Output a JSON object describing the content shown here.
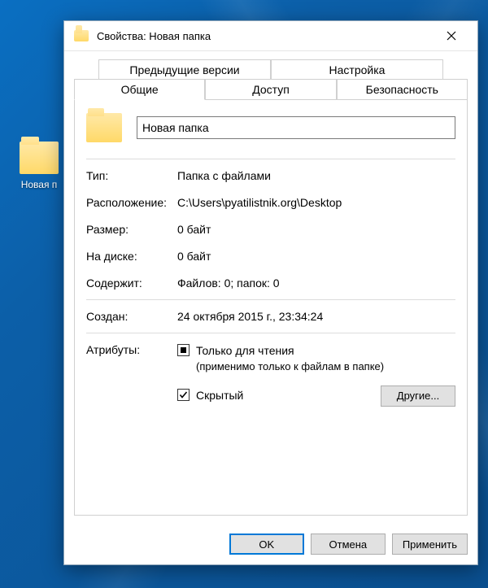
{
  "desktop": {
    "icon_label": "Новая п"
  },
  "dialog": {
    "title": "Свойства: Новая папка",
    "tabs": {
      "prev_versions": "Предыдущие версии",
      "settings": "Настройка",
      "general": "Общие",
      "sharing": "Доступ",
      "security": "Безопасность"
    },
    "folder_name": "Новая папка",
    "props": {
      "type_label": "Тип:",
      "type_value": "Папка с файлами",
      "location_label": "Расположение:",
      "location_value": "C:\\Users\\pyatilistnik.org\\Desktop",
      "size_label": "Размер:",
      "size_value": "0 байт",
      "size_on_disk_label": "На диске:",
      "size_on_disk_value": "0 байт",
      "contains_label": "Содержит:",
      "contains_value": "Файлов: 0; папок: 0",
      "created_label": "Создан:",
      "created_value": "24 октября 2015 г., 23:34:24"
    },
    "attributes": {
      "label": "Атрибуты:",
      "readonly": "Только для чтения",
      "readonly_note": "(применимо только к файлам в папке)",
      "hidden": "Скрытый",
      "advanced_btn": "Другие..."
    },
    "buttons": {
      "ok": "OK",
      "cancel": "Отмена",
      "apply": "Применить"
    }
  }
}
